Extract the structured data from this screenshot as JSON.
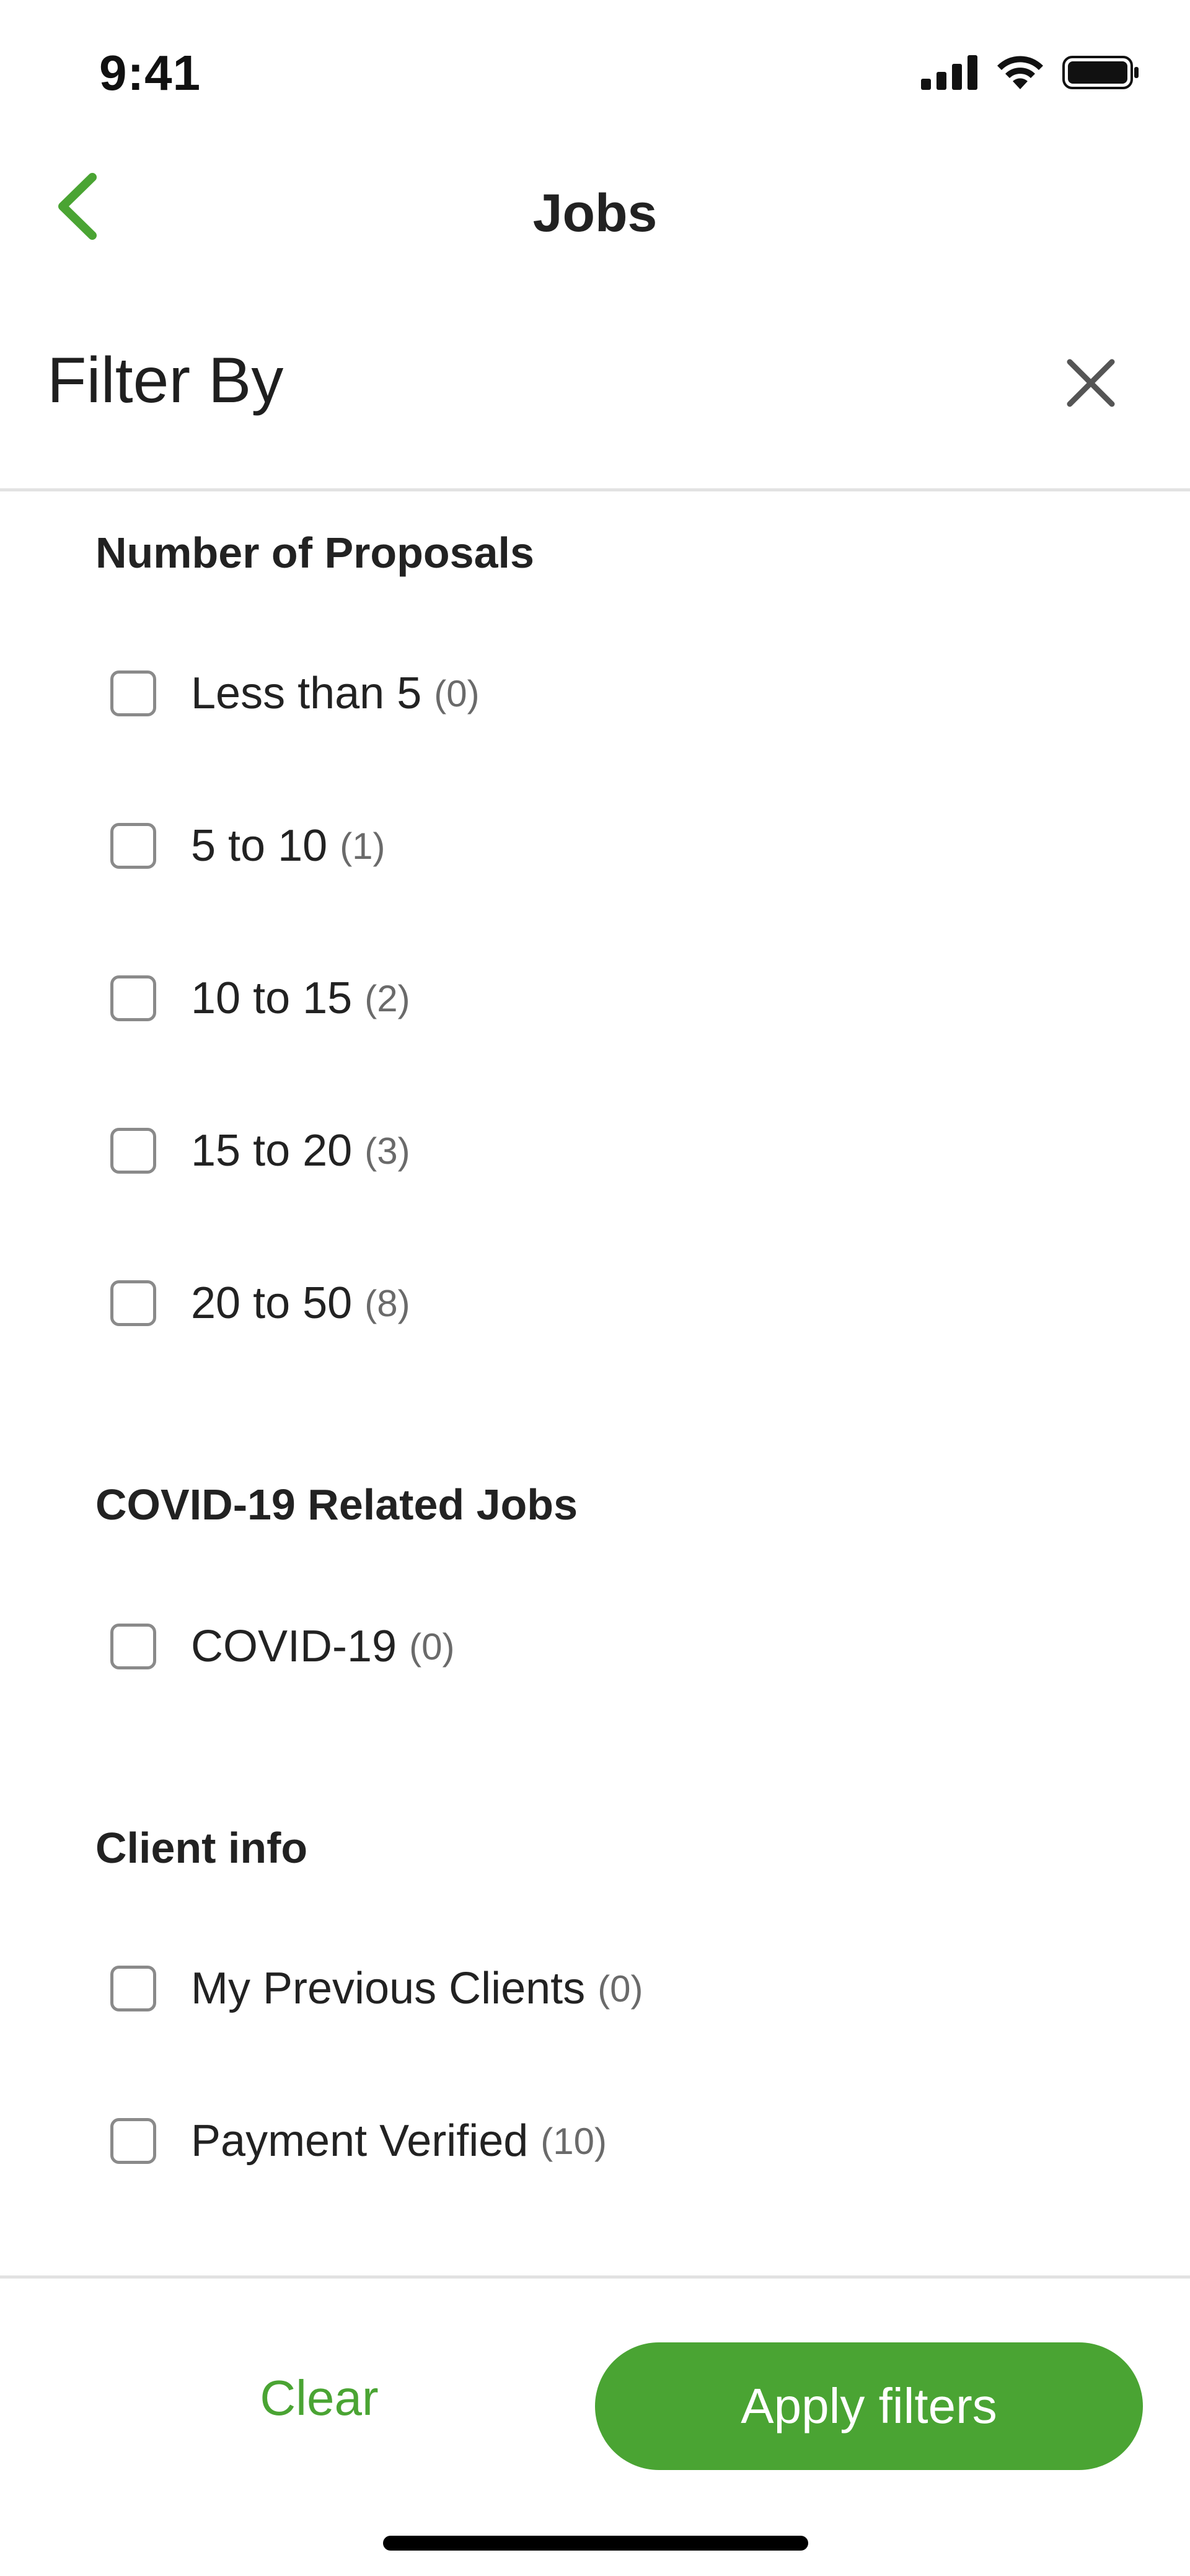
{
  "status_bar": {
    "time": "9:41",
    "icons": [
      "cellular-signal-icon",
      "wifi-icon",
      "battery-icon"
    ]
  },
  "nav": {
    "title": "Jobs",
    "back_icon": "chevron-left-icon"
  },
  "filter": {
    "title": "Filter By",
    "close_icon": "close-icon"
  },
  "sections": [
    {
      "heading": "Number of Proposals",
      "options": [
        {
          "label": "Less than 5",
          "count": "(0)",
          "checked": false
        },
        {
          "label": "5 to 10",
          "count": "(1)",
          "checked": false
        },
        {
          "label": "10 to 15",
          "count": "(2)",
          "checked": false
        },
        {
          "label": "15 to 20",
          "count": "(3)",
          "checked": false
        },
        {
          "label": "20 to 50",
          "count": "(8)",
          "checked": false
        }
      ]
    },
    {
      "heading": "COVID-19 Related Jobs",
      "options": [
        {
          "label": "COVID-19",
          "count": "(0)",
          "checked": false
        }
      ]
    },
    {
      "heading": "Client info",
      "options": [
        {
          "label": "My Previous Clients",
          "count": "(0)",
          "checked": false
        },
        {
          "label": "Payment Verified",
          "count": "(10)",
          "checked": false
        }
      ]
    }
  ],
  "footer": {
    "clear_label": "Clear",
    "apply_label": "Apply filters"
  },
  "colors": {
    "accent": "#4aa433",
    "text": "#222222",
    "muted": "#6a6a6a",
    "divider": "#e2e2e2"
  }
}
